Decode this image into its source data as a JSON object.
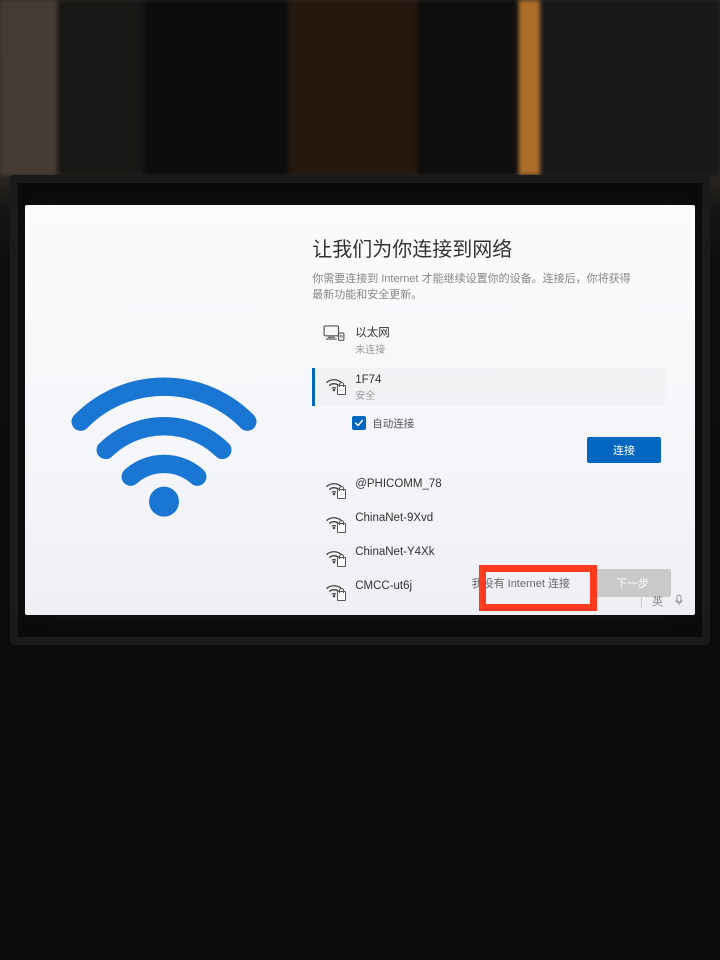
{
  "oobe": {
    "title": "让我们为你连接到网络",
    "subtitle": "你需要连接到 Internet 才能继续设置你的设备。连接后，你将获得最新功能和安全更新。",
    "ethernet": {
      "name": "以太网",
      "status": "未连接"
    },
    "selected_network": {
      "ssid": "1F74",
      "security": "安全",
      "auto_connect_label": "自动连接",
      "auto_connect_checked": true,
      "connect_button": "连接"
    },
    "networks": [
      {
        "ssid": "@PHICOMM_78",
        "secured": true
      },
      {
        "ssid": "ChinaNet-9Xvd",
        "secured": true
      },
      {
        "ssid": "ChinaNet-Y4Xk",
        "secured": true
      },
      {
        "ssid": "CMCC-ut6j",
        "secured": true
      }
    ],
    "skip_button": "我没有 Internet 连接",
    "next_button": "下一步"
  },
  "ime": {
    "lang": "英"
  },
  "colors": {
    "accent": "#0067c0",
    "highlight": "#ff3b1f"
  }
}
